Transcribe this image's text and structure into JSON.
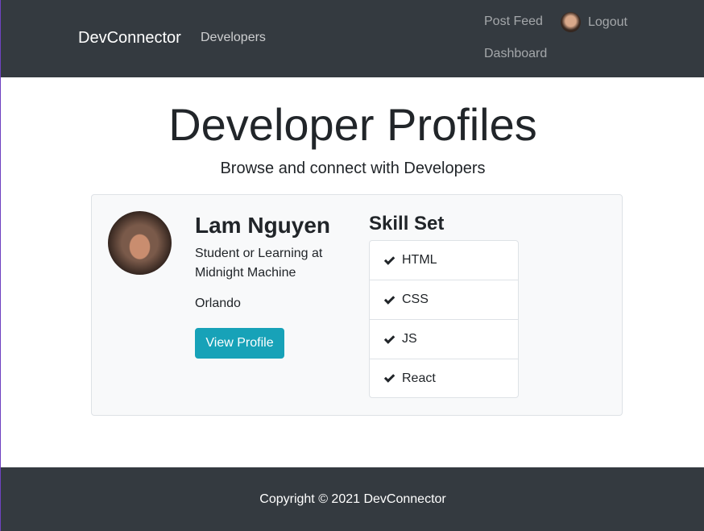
{
  "navbar": {
    "brand": "DevConnector",
    "developers": "Developers",
    "post_feed": "Post Feed",
    "dashboard": "Dashboard",
    "logout": "Logout"
  },
  "header": {
    "title": "Developer Profiles",
    "subtitle": "Browse and connect with Developers"
  },
  "profile": {
    "name": "Lam Nguyen",
    "status": "Student or Learning at Midnight Machine",
    "location": "Orlando",
    "view_button": "View Profile",
    "skills_title": "Skill Set",
    "skills": [
      "HTML",
      "CSS",
      "JS",
      "React"
    ]
  },
  "footer": {
    "copyright": "Copyright © 2021 DevConnector"
  },
  "colors": {
    "navbar_bg": "#343a40",
    "button_info": "#17a2b8",
    "card_bg": "#f8f9fa"
  }
}
